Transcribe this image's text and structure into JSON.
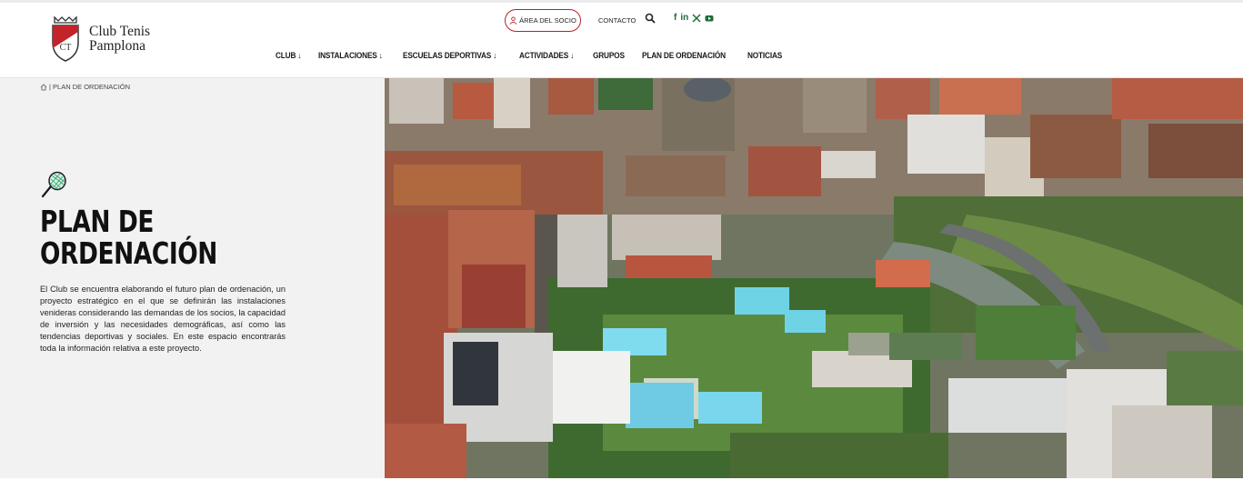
{
  "brand": {
    "name_line1": "Club Tenis",
    "name_line2": "Pamplona",
    "crest_initials": "CT"
  },
  "header": {
    "socio_button": "ÁREA DEL SOCIO",
    "contact": "CONTACTO",
    "icons": [
      "search-icon",
      "facebook-icon",
      "linkedin-icon",
      "x-icon",
      "youtube-icon"
    ],
    "social_colors": {
      "social": "#1c6b3a",
      "accent": "#b3232a"
    }
  },
  "nav": {
    "items": [
      {
        "label": "CLUB ↓"
      },
      {
        "label": "INSTALACIONES ↓"
      },
      {
        "label": "ESCUELAS DEPORTIVAS ↓"
      },
      {
        "label": "ACTIVIDADES ↓"
      },
      {
        "label": "GRUPOS"
      },
      {
        "label": "PLAN DE ORDENACIÓN"
      },
      {
        "label": "NOTICIAS"
      }
    ]
  },
  "breadcrumb": {
    "current": "| PLAN DE ORDENACIÓN"
  },
  "hero": {
    "title": "PLAN DE\nORDENACIÓN",
    "description": "El Club se encuentra elaborando el futuro plan de ordenación, un proyecto estratégico en el que se definirán las instalaciones venideras considerando las demandas de los socios, la capacidad de inversión y las necesidades demográficas, así como las tendencias deportivas y sociales. En este espacio encontrarás toda la información relativa a este proyecto."
  }
}
